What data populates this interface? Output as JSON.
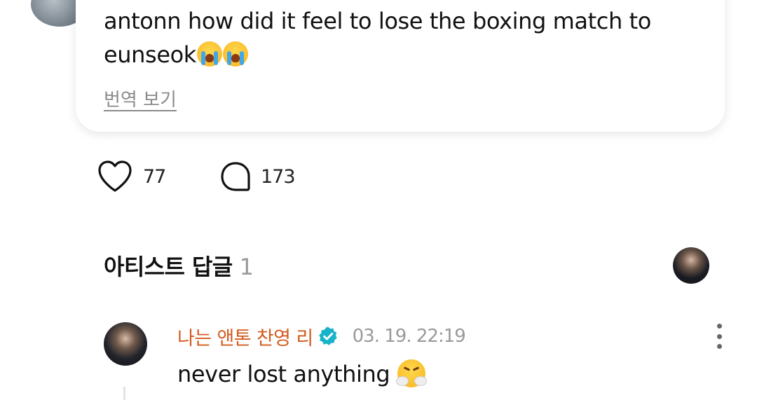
{
  "post": {
    "text": "antonn how did it feel to lose the boxing match to eunseok",
    "translate_label": "번역 보기"
  },
  "actions": {
    "likes": "77",
    "comments": "173"
  },
  "artist_replies": {
    "title": "아티스트 답글",
    "count": "1"
  },
  "reply": {
    "author": "나는 앤톤 찬영 리",
    "timestamp": "03. 19. 22:19",
    "text": "never lost anything"
  },
  "colors": {
    "author_name": "#d35b1f",
    "verified_badge": "#19b3c9",
    "muted_text": "#9a9a9a"
  },
  "icons": {
    "like": "heart-icon",
    "comment": "speech-bubble-icon",
    "verified": "verified-badge-icon",
    "more": "more-vertical-icon",
    "emoji_post": "loudly-crying-face-emoji",
    "emoji_reply": "face-with-steam-emoji"
  }
}
